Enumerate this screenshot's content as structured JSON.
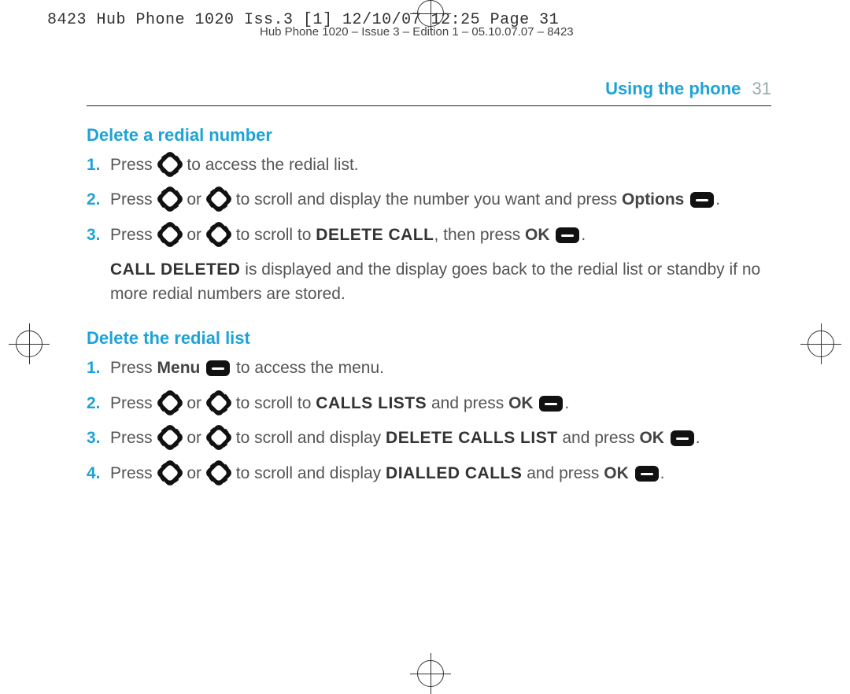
{
  "meta": {
    "topline": "8423 Hub Phone 1020 Iss.3 [1]  12/10/07  12:25  Page 31",
    "small": "Hub Phone 1020 – Issue 3 – Edition 1 – 05.10.07.07 – 8423"
  },
  "header": {
    "title": "Using the phone",
    "page": "31"
  },
  "section1": {
    "title": "Delete a redial number",
    "s1": {
      "n": "1.",
      "a": "Press",
      "b": "to access the redial list."
    },
    "s2": {
      "n": "2.",
      "a": "Press",
      "or": "or",
      "b": "to scroll and display the number you want and press",
      "opt": "Options",
      "dot": "."
    },
    "s3": {
      "n": "3.",
      "a": "Press",
      "or": "or",
      "b": "to scroll to",
      "dc": "DELETE CALL",
      "then": ", then press",
      "ok": "OK",
      "dot": "."
    },
    "note": {
      "cd": "CALL DELETED",
      "rest": " is displayed and the display goes back to the redial list or standby if no more redial numbers are stored."
    }
  },
  "section2": {
    "title": "Delete the redial list",
    "s1": {
      "n": "1.",
      "a": "Press",
      "menu": "Menu",
      "b": "to access the menu."
    },
    "s2": {
      "n": "2.",
      "a": "Press",
      "or": "or",
      "b": "to scroll to",
      "cl": "CALLS LISTS",
      "and": "and press",
      "ok": "OK",
      "dot": "."
    },
    "s3": {
      "n": "3.",
      "a": "Press",
      "or": "or",
      "b": "to scroll and display",
      "dcl": "DELETE CALLS LIST",
      "and": "and press",
      "ok": "OK",
      "dot": "."
    },
    "s4": {
      "n": "4.",
      "a": "Press",
      "or": "or",
      "b": "to scroll and display",
      "dc": "DIALLED CALLS",
      "and": "and press",
      "ok": "OK",
      "dot": "."
    }
  }
}
